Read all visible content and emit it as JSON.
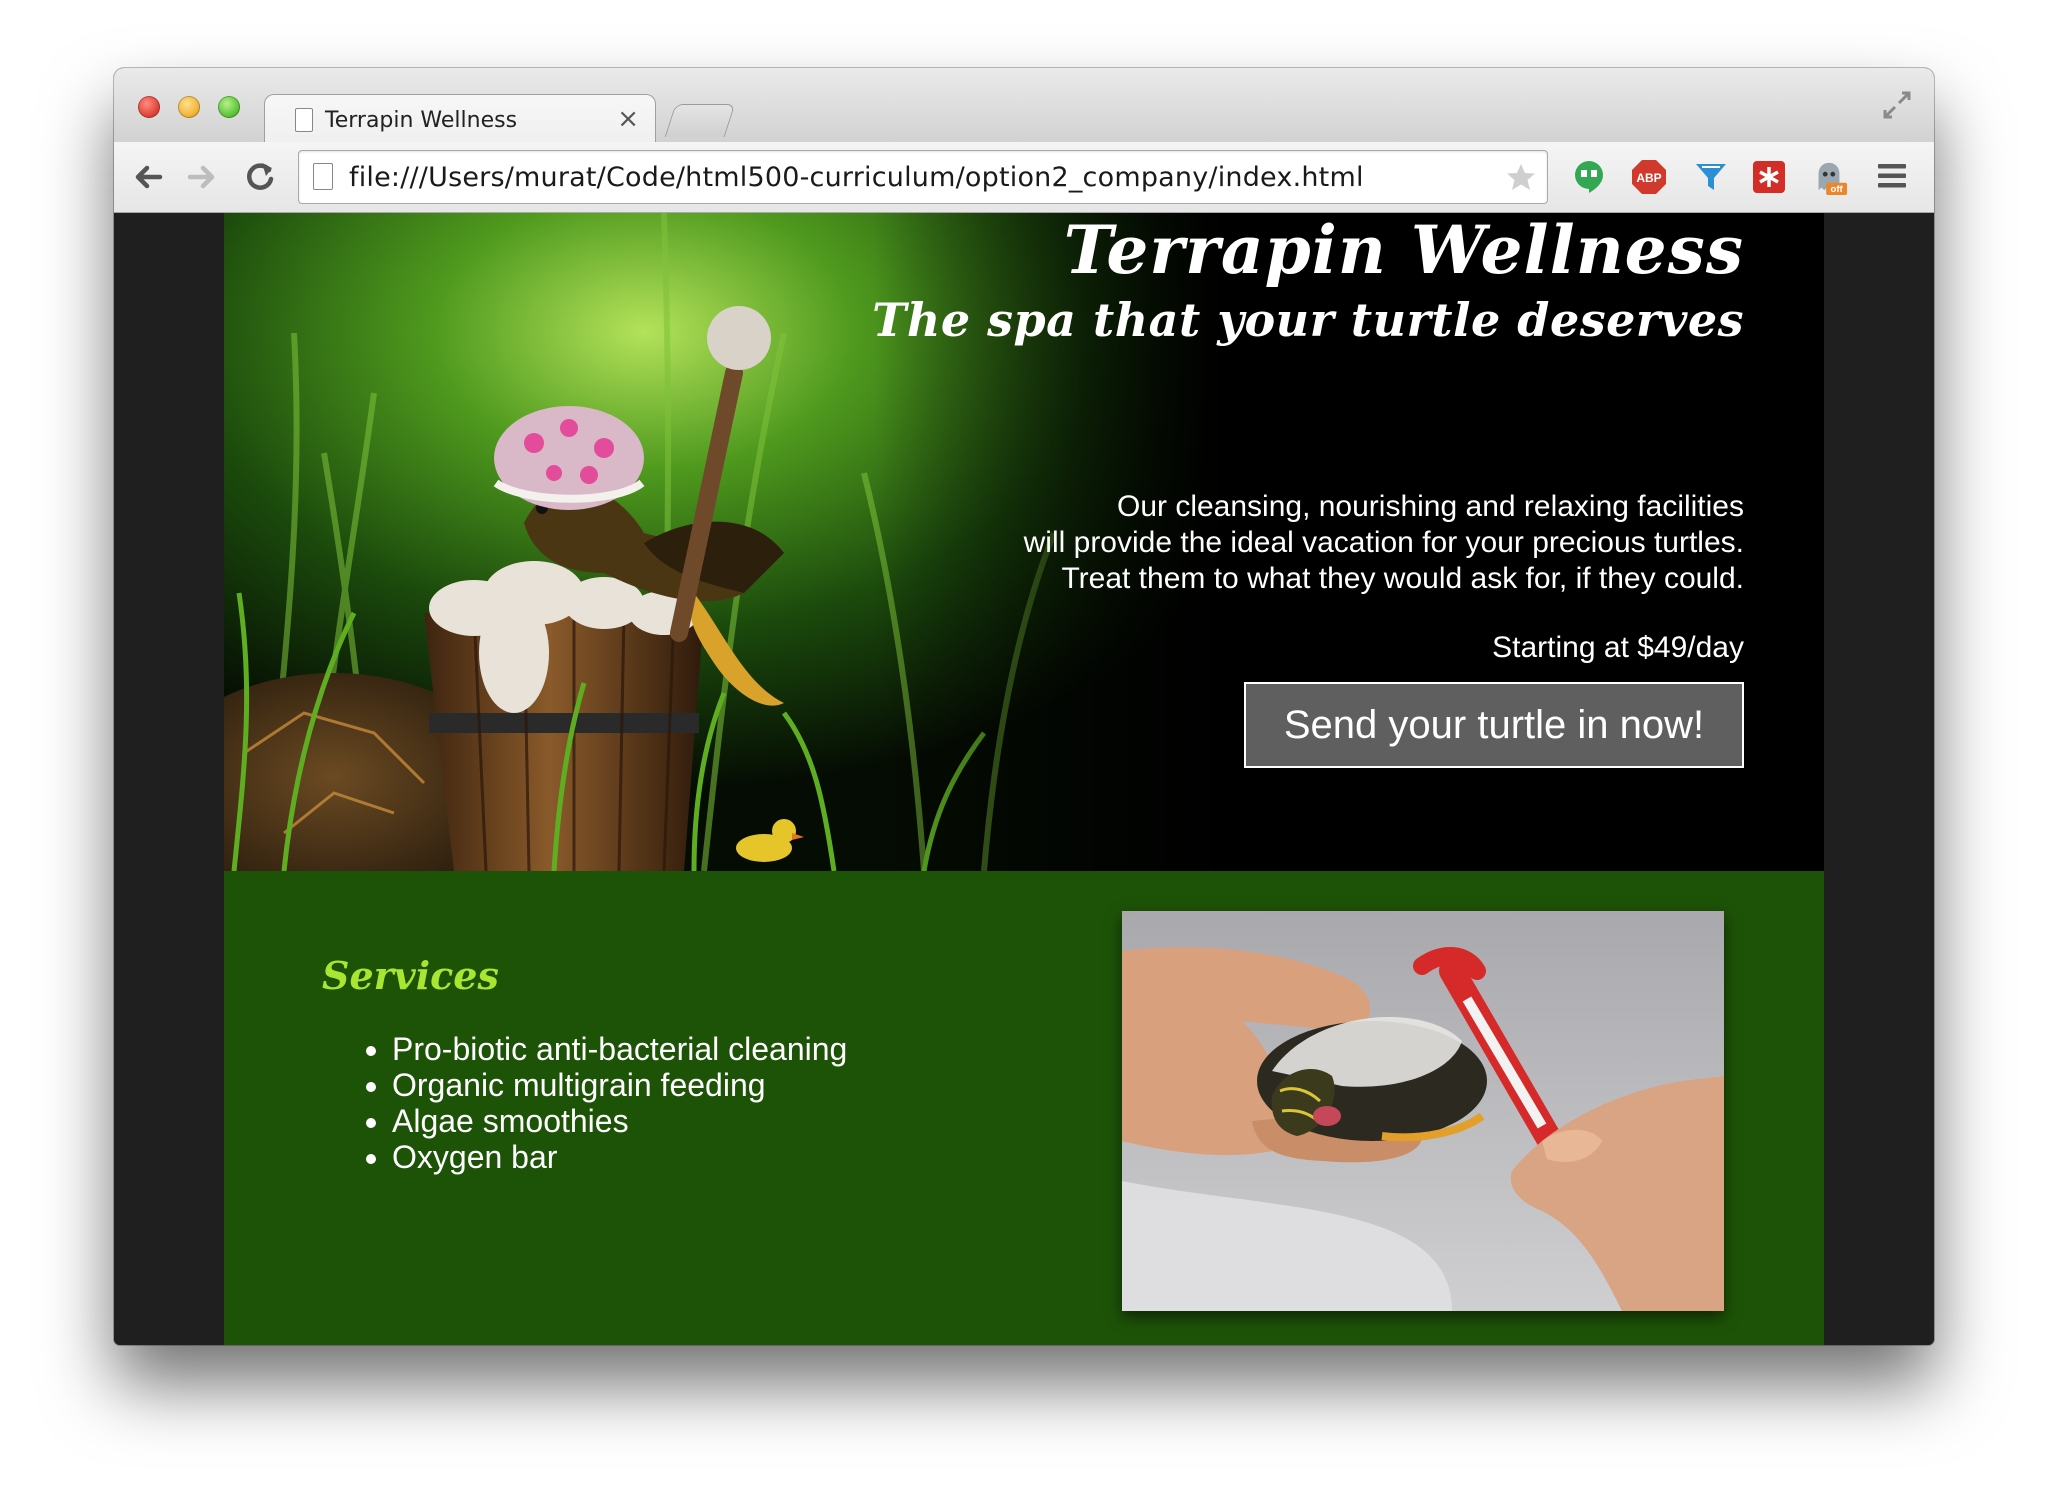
{
  "browser": {
    "tab_title": "Terrapin Wellness",
    "tab_close": "×",
    "url": "file:///Users/murat/Code/html500-curriculum/option2_company/index.html",
    "extensions": [
      "hangouts-icon",
      "adblock-plus-icon",
      "filter-icon",
      "lastpass-icon",
      "ghostery-icon"
    ],
    "abp_label": "ABP",
    "ghostery_badge": "off"
  },
  "hero": {
    "title": "Terrapin Wellness",
    "tagline": "The spa that your turtle deserves",
    "description": [
      "Our cleansing, nourishing and relaxing facilities",
      "will provide the ideal vacation for your precious turtles.",
      "Treat them to what they would ask for, if they could."
    ],
    "price": "Starting at $49/day",
    "cta_label": "Send your turtle in now!"
  },
  "services": {
    "title": "Services",
    "items": [
      "Pro-biotic anti-bacterial cleaning",
      "Organic multigrain feeding",
      "Algae smoothies",
      "Oxygen bar"
    ]
  },
  "colors": {
    "services_bg": "#1d5307",
    "services_title": "#a8e632",
    "cta_bg": "#5f5f5f",
    "page_bg": "#1f1f1f"
  }
}
